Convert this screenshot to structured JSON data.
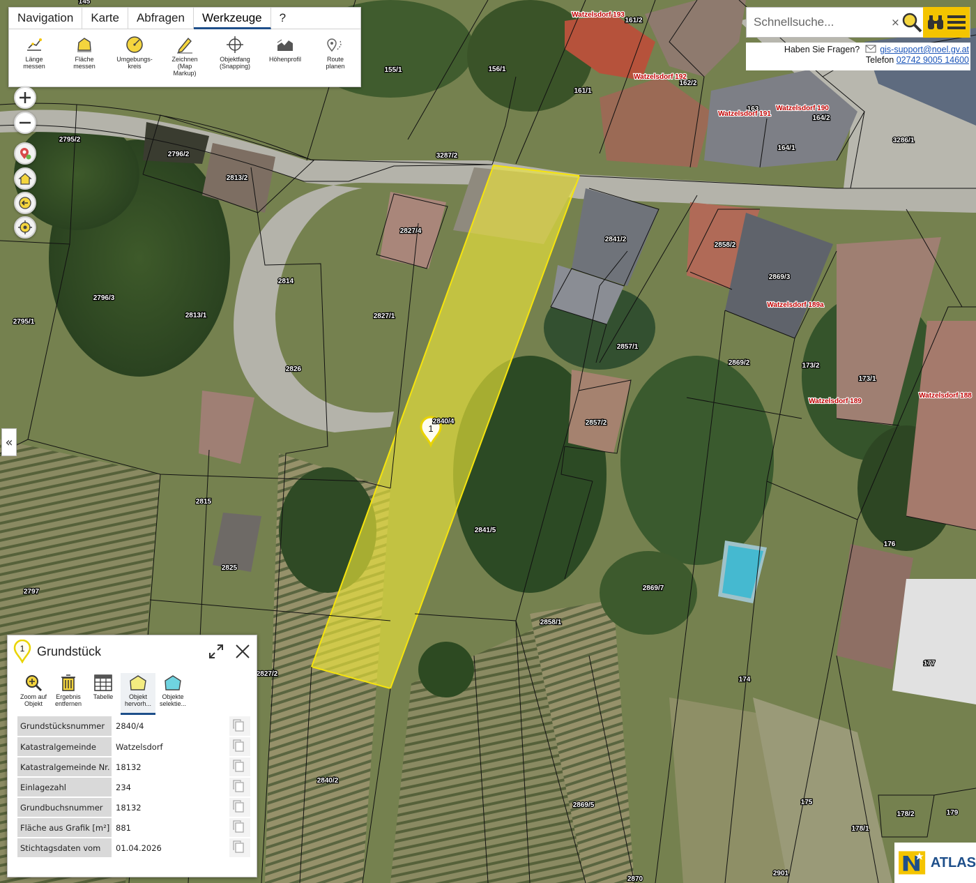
{
  "toolbar": {
    "tabs": [
      "Navigation",
      "Karte",
      "Abfragen",
      "Werkzeuge",
      "?"
    ],
    "active_tab": "Werkzeuge",
    "tools": [
      {
        "label": "Länge\nmessen",
        "icon": "measure-length-icon"
      },
      {
        "label": "Fläche\nmessen",
        "icon": "measure-area-icon"
      },
      {
        "label": "Umgebungs-\nkreis",
        "icon": "radius-icon"
      },
      {
        "label": "Zeichnen\n(Map\nMarkup)",
        "icon": "pencil-icon"
      },
      {
        "label": "Objektfang\n(Snapping)",
        "icon": "crosshair-icon"
      },
      {
        "label": "Höhenprofil",
        "icon": "elevation-profile-icon"
      },
      {
        "label": "Route\nplanen",
        "icon": "route-icon"
      }
    ]
  },
  "search": {
    "placeholder": "Schnellsuche...",
    "clear": "×"
  },
  "help": {
    "question": "Haben Sie Fragen?",
    "email": "gis-support@noel.gv.at",
    "phone_label": "Telefon",
    "phone": "02742 9005 14600"
  },
  "collapse_symbol": "«",
  "map": {
    "marker_number": "1",
    "marker_parcel": "2840/4",
    "parcels": [
      "2795/2",
      "2796/2",
      "2813/2",
      "3287/2",
      "2827/4",
      "2841/2",
      "2858/2",
      "2869/3",
      "2796/3",
      "2795/1",
      "2813/1",
      "2814",
      "2827/1",
      "2826",
      "2857/1",
      "2869/2",
      "173/2",
      "173/1",
      "2857/2",
      "2815",
      "2825",
      "2797",
      "2841/5",
      "2869/7",
      "2858/1",
      "176",
      "177",
      "174",
      "175",
      "2840/2",
      "2869/5",
      "178/2",
      "178/1",
      "179",
      "2870",
      "2901",
      "2827/2",
      "155/1",
      "156/1",
      "161/1",
      "161/2",
      "162/2",
      "163",
      "164/2",
      "164/1",
      "3286/1",
      "145"
    ],
    "addresses": [
      "Watzelsdorf 193",
      "Watzelsdorf 192",
      "Watzelsdorf 191",
      "Watzelsdorf 190",
      "Watzelsdorf 189a",
      "Watzelsdorf 189",
      "Watzelsdorf 188"
    ]
  },
  "info": {
    "marker_number": "1",
    "title": "Grundstück",
    "tools": [
      {
        "label": "Zoom auf\nObjekt",
        "icon": "zoom-to-object-icon"
      },
      {
        "label": "Ergebnis\nentfernen",
        "icon": "trash-icon"
      },
      {
        "label": "Tabelle",
        "icon": "table-icon"
      },
      {
        "label": "Objekt\nhervorh...",
        "icon": "highlight-object-icon"
      },
      {
        "label": "Objekte\nselektie...",
        "icon": "select-objects-icon"
      }
    ],
    "active_tool": "Objekt hervorh...",
    "rows": [
      {
        "key": "Grundstücksnummer",
        "value": "2840/4"
      },
      {
        "key": "Katastralgemeinde",
        "value": "Watzelsdorf"
      },
      {
        "key": "Katastralgemeinde Nr.",
        "value": "18132"
      },
      {
        "key": "Einlagezahl",
        "value": "234"
      },
      {
        "key": "Grundbuchsnummer",
        "value": "18132"
      },
      {
        "key": "Fläche aus Grafik [m²]",
        "value": "881"
      },
      {
        "key": "Stichtagsdaten vom",
        "value": "01.04.2026"
      }
    ]
  },
  "logo": {
    "text": "ATLAS"
  },
  "colors": {
    "highlight": "#f2ea3a",
    "accent": "#f4c400",
    "tab_underline": "#1e4f8a",
    "address_label": "#c00000"
  }
}
